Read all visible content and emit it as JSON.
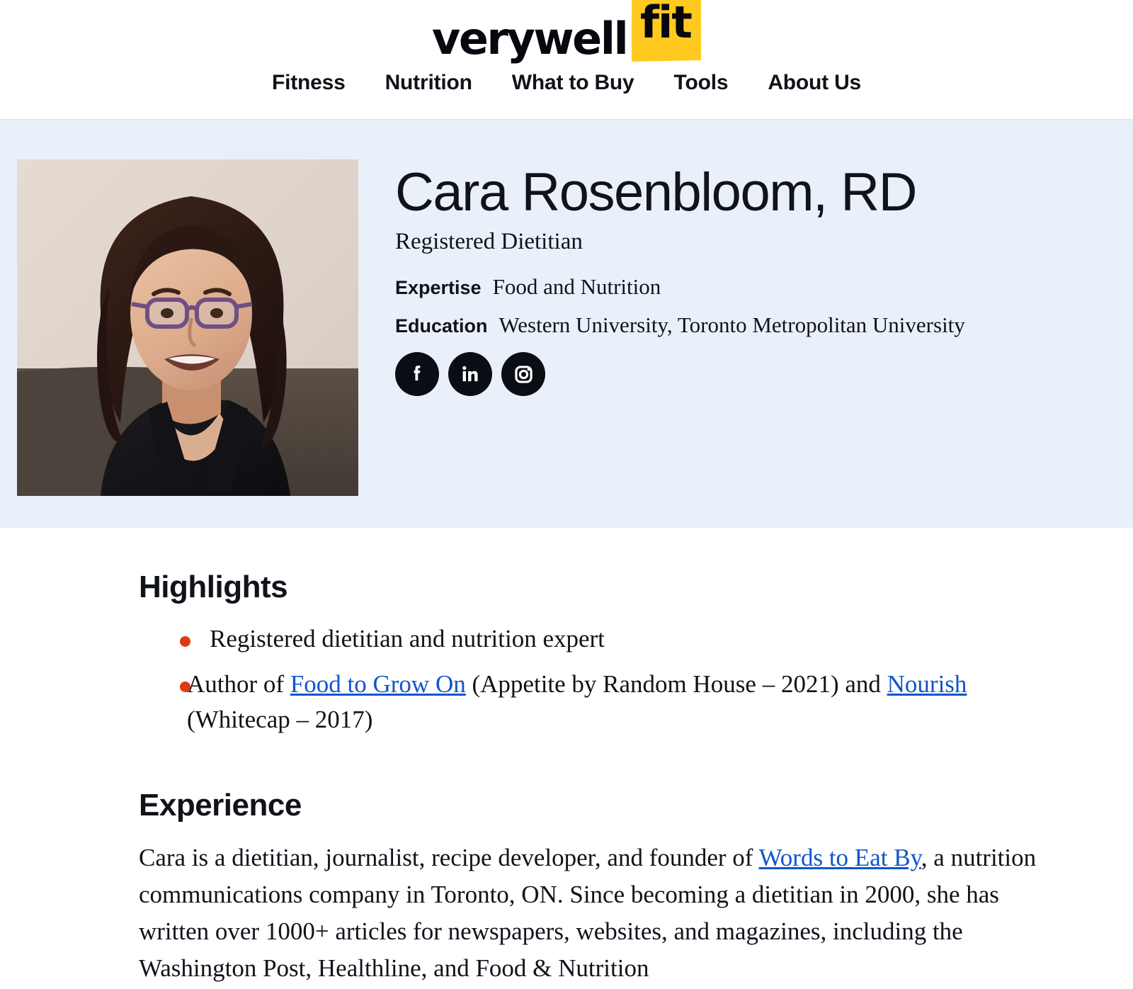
{
  "header": {
    "logo": {
      "word": "verywell",
      "badge": "fit",
      "badge_color": "#FFC91F"
    },
    "nav": [
      {
        "label": "Fitness",
        "name": "nav-item-fitness"
      },
      {
        "label": "Nutrition",
        "name": "nav-item-nutrition"
      },
      {
        "label": "What to Buy",
        "name": "nav-item-what-to-buy"
      },
      {
        "label": "Tools",
        "name": "nav-item-tools"
      },
      {
        "label": "About Us",
        "name": "nav-item-about-us"
      }
    ]
  },
  "hero": {
    "background_color": "#EAF0FA",
    "portrait_alt": "Cara Rosenbloom headshot",
    "name": "Cara Rosenbloom, RD",
    "title": "Registered Dietitian",
    "meta": [
      {
        "label": "Expertise",
        "value": "Food and Nutrition"
      },
      {
        "label": "Education",
        "value": "Western University, Toronto Metropolitan University"
      }
    ],
    "socials": [
      {
        "icon": "facebook-icon",
        "label": "Facebook"
      },
      {
        "icon": "linkedin-icon",
        "label": "LinkedIn"
      },
      {
        "icon": "instagram-icon",
        "label": "Instagram"
      }
    ]
  },
  "highlights": {
    "heading": "Highlights",
    "bullet_color": "#DE3A11",
    "items": [
      {
        "parts": [
          {
            "type": "text",
            "text": "Registered dietitian and nutrition expert"
          }
        ]
      },
      {
        "parts": [
          {
            "type": "text",
            "text": "Author of "
          },
          {
            "type": "link",
            "text": "Food to Grow On"
          },
          {
            "type": "text",
            "text": " (Appetite by Random House – 2021) and "
          },
          {
            "type": "link",
            "text": "Nourish"
          },
          {
            "type": "text",
            "text": " (Whitecap – 2017)"
          }
        ]
      }
    ]
  },
  "experience": {
    "heading": "Experience",
    "paragraph_parts": [
      {
        "type": "text",
        "text": "Cara is a dietitian, journalist, recipe developer, and founder of "
      },
      {
        "type": "link",
        "text": "Words to Eat By"
      },
      {
        "type": "text",
        "text": ", a nutrition communications company in Toronto, ON. Since becoming a dietitian in 2000, she has written over 1000+ articles for newspapers, websites, and magazines, including the Washington Post, Healthline, and Food & Nutrition"
      }
    ]
  },
  "colors": {
    "link": "#1155cc",
    "text": "#10131a",
    "hero_bg": "#EAF0FA",
    "brand_yellow": "#FFC91F",
    "bullet_red": "#DE3A11"
  }
}
